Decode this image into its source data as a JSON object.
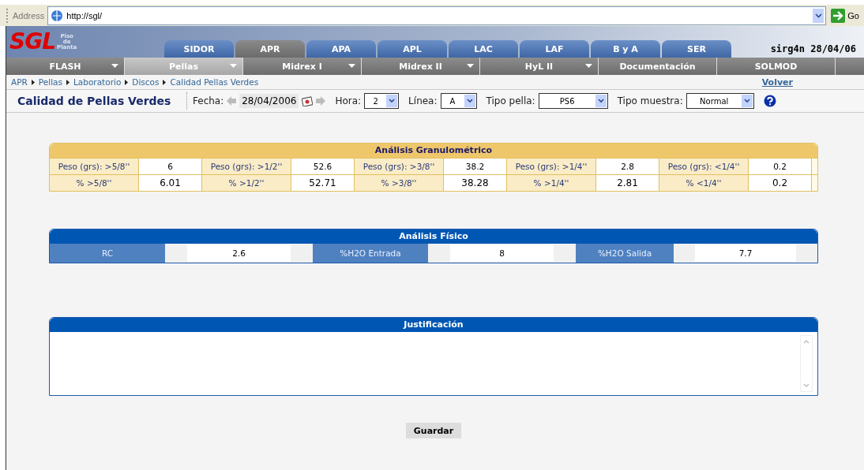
{
  "address_bar": {
    "label": "Address",
    "url": "http://sgl/",
    "go": "Go"
  },
  "header": {
    "logo": "SGL",
    "logo_sub": [
      "Piso",
      "de",
      "Planta"
    ],
    "user_info": "sirg4n 28/04/06"
  },
  "tabs": [
    {
      "label": "SIDOR",
      "selected": false
    },
    {
      "label": "APR",
      "selected": true
    },
    {
      "label": "APA",
      "selected": false
    },
    {
      "label": "APL",
      "selected": false
    },
    {
      "label": "LAC",
      "selected": false
    },
    {
      "label": "LAF",
      "selected": false
    },
    {
      "label": "B y A",
      "selected": false
    },
    {
      "label": "SER",
      "selected": false
    }
  ],
  "menu": [
    {
      "label": "FLASH",
      "selected": false,
      "dropdown": true
    },
    {
      "label": "Pellas",
      "selected": true,
      "dropdown": true
    },
    {
      "label": "Midrex I",
      "selected": false,
      "dropdown": true
    },
    {
      "label": "Midrex II",
      "selected": false,
      "dropdown": true
    },
    {
      "label": "HyL II",
      "selected": false,
      "dropdown": true
    },
    {
      "label": "Documentación",
      "selected": false,
      "dropdown": false
    },
    {
      "label": "SOLMOD",
      "selected": false,
      "dropdown": false
    }
  ],
  "breadcrumb": [
    "APR",
    "Pellas",
    "Laboratorio",
    "Discos",
    "Calidad Pellas Verdes"
  ],
  "back_link": "Volver",
  "toolbar": {
    "title": "Calidad de Pellas Verdes",
    "date_label": "Fecha:",
    "date": "28/04/2006",
    "fields": [
      {
        "label": "Hora:",
        "value": "2"
      },
      {
        "label": "Línea:",
        "value": "A"
      },
      {
        "label": "Tipo pella:",
        "value": "PS6"
      },
      {
        "label": "Tipo muestra:",
        "value": "Normal"
      }
    ]
  },
  "granulometric": {
    "title": "Análisis Granulométrico",
    "rows": [
      [
        {
          "label": "Peso (grs): >5/8''",
          "value": "6"
        },
        {
          "label": "Peso (grs): >1/2''",
          "value": "52.6"
        },
        {
          "label": "Peso (grs): >3/8''",
          "value": "38.2"
        },
        {
          "label": "Peso (grs): >1/4''",
          "value": "2.8"
        },
        {
          "label": "Peso (grs): <1/4''",
          "value": "0.2"
        }
      ],
      [
        {
          "label": "% >5/8''",
          "value": "6.01"
        },
        {
          "label": "% >1/2''",
          "value": "52.71"
        },
        {
          "label": "% >3/8''",
          "value": "38.28"
        },
        {
          "label": "% >1/4''",
          "value": "2.81"
        },
        {
          "label": "% <1/4''",
          "value": "0.2"
        }
      ]
    ]
  },
  "physical": {
    "title": "Análisis Físico",
    "cells": [
      {
        "label": "RC",
        "value": "2.6"
      },
      {
        "label": "%H2O Entrada",
        "value": "8"
      },
      {
        "label": "%H2O Salida",
        "value": "7.7"
      }
    ]
  },
  "justification": {
    "title": "Justificación"
  },
  "save_button": "Guardar"
}
